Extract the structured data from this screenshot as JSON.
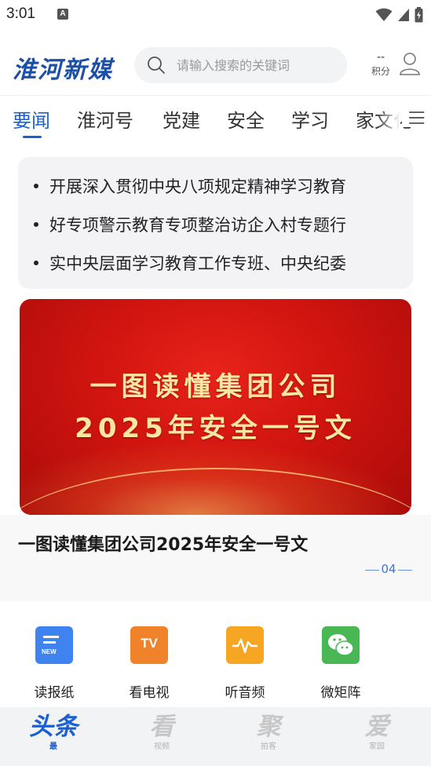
{
  "status_bar": {
    "time": "3:01",
    "notification_icon_letter": "A",
    "icons": [
      "wifi-icon",
      "cell-signal-icon",
      "battery-icon"
    ]
  },
  "header": {
    "logo_text": "淮河新媒",
    "search_placeholder": "请输入搜索的关键词",
    "points_value": "--",
    "points_label": "积分",
    "accent_color": "#1c5fd0"
  },
  "tabs": [
    {
      "label": "要闻",
      "active": true
    },
    {
      "label": "淮河号",
      "active": false
    },
    {
      "label": "党建",
      "active": false
    },
    {
      "label": "安全",
      "active": false
    },
    {
      "label": "学习",
      "active": false
    },
    {
      "label": "家文化",
      "active": false
    }
  ],
  "ticker": [
    "开展深入贯彻中央八项规定精神学习教育",
    "好专项警示教育专项整治访企入村专题行",
    "实中央层面学习教育工作专班、中央纪委"
  ],
  "banner": {
    "line1": "一图读懂集团公司",
    "line2": "2025年安全一号文"
  },
  "caption": {
    "title": "一图读懂集团公司2025年安全一号文",
    "page_number": "04"
  },
  "quick_links": [
    {
      "label": "读报纸",
      "icon": "newspaper-icon",
      "icon_badge": "NEW",
      "color": "#3f83f0"
    },
    {
      "label": "看电视",
      "icon": "tv-icon",
      "icon_badge": "TV",
      "color": "#f0822a"
    },
    {
      "label": "听音频",
      "icon": "audio-icon",
      "icon_badge": "",
      "color": "#f6a623"
    },
    {
      "label": "微矩阵",
      "icon": "wechat-icon",
      "icon_badge": "",
      "color": "#48b754"
    }
  ],
  "bottom_nav": [
    {
      "glyph": "头条",
      "sub": "最",
      "active": true
    },
    {
      "glyph": "看",
      "sub": "视频",
      "active": false
    },
    {
      "glyph": "聚",
      "sub": "拍客",
      "active": false
    },
    {
      "glyph": "爱",
      "sub": "家园",
      "active": false
    }
  ]
}
